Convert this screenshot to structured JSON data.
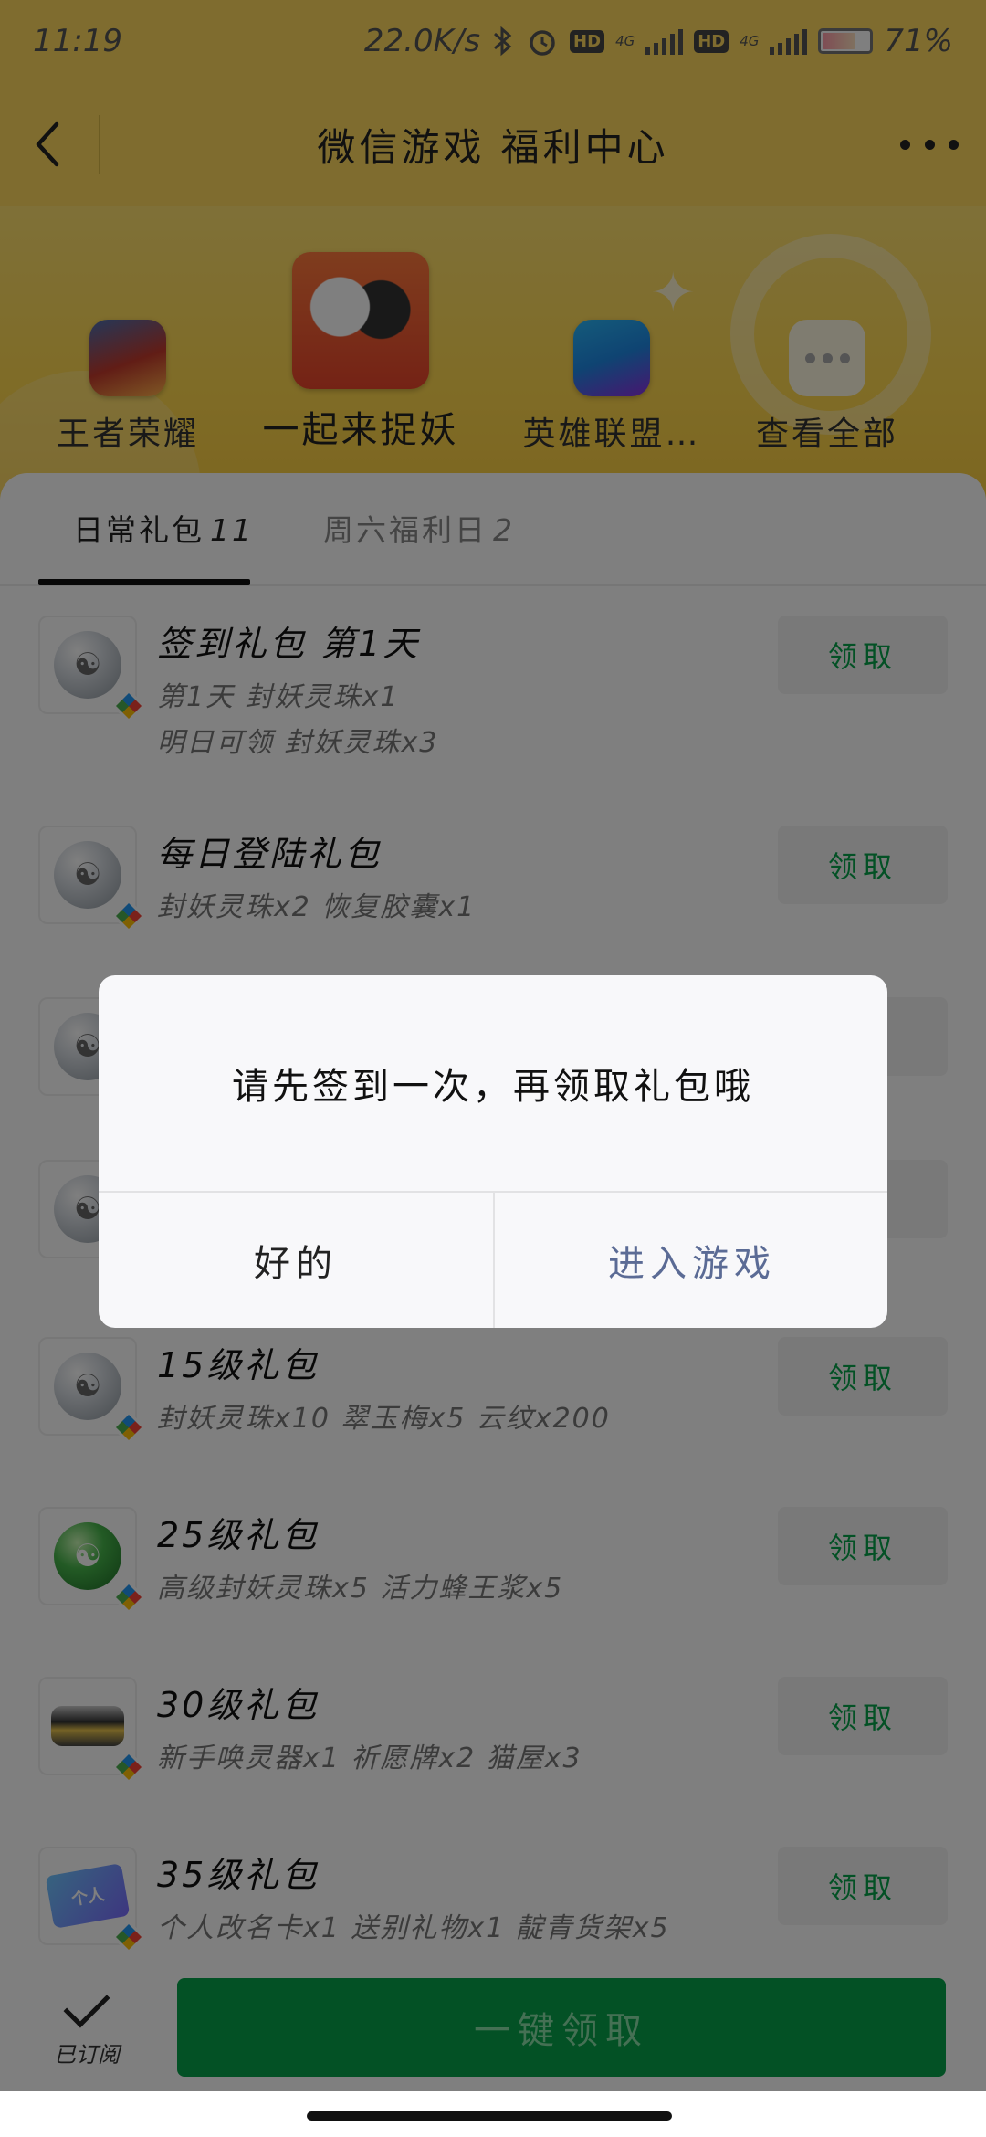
{
  "status_bar": {
    "time": "11:19",
    "net_speed": "22.0K/s",
    "hd1": "HD",
    "net1": "4G",
    "hd2": "HD",
    "net2": "4G",
    "battery": "71%",
    "battery_level": 0.71
  },
  "nav": {
    "title": "微信游戏 福利中心"
  },
  "games": [
    {
      "label": "王者荣耀",
      "icon": "honor-of-kings-icon"
    },
    {
      "label": "一起来捉妖",
      "icon": "catch-demon-icon"
    },
    {
      "label": "英雄联盟…",
      "icon": "league-of-legends-icon"
    },
    {
      "label": "查看全部",
      "icon": "more-dots-icon"
    }
  ],
  "tabs": [
    {
      "label": "日常礼包",
      "count": "11"
    },
    {
      "label": "周六福利日",
      "count": "2"
    }
  ],
  "items": [
    {
      "name": "签到礼包 第1天",
      "desc": "第1天 封妖灵珠x1",
      "desc2": "明日可领 封妖灵珠x3",
      "button": "领取"
    },
    {
      "name": "每日登陆礼包",
      "desc": "封妖灵珠x2 恢复胶囊x1",
      "button": "领取"
    },
    {
      "name": "15级礼包",
      "desc": "封妖灵珠x10 翠玉梅x5 云纹x200",
      "button": "领取"
    },
    {
      "name": "25级礼包",
      "desc": "高级封妖灵珠x5 活力蜂王浆x5",
      "button": "领取"
    },
    {
      "name": "30级礼包",
      "desc": "新手唤灵器x1 祈愿牌x2 猫屋x3",
      "button": "领取"
    },
    {
      "name": "35级礼包",
      "desc": "个人改名卡x1 送别礼物x1 靛青货架x5",
      "button": "领取"
    }
  ],
  "bottom": {
    "subscribed": "已订阅",
    "one_key": "一键领取"
  },
  "dialog": {
    "message": "请先签到一次，再领取礼包哦",
    "ok": "好的",
    "enter": "进入游戏"
  },
  "colors": {
    "header": "#ffd95e",
    "accent_green": "#07a24a",
    "dialog_link": "#5b6b95"
  }
}
